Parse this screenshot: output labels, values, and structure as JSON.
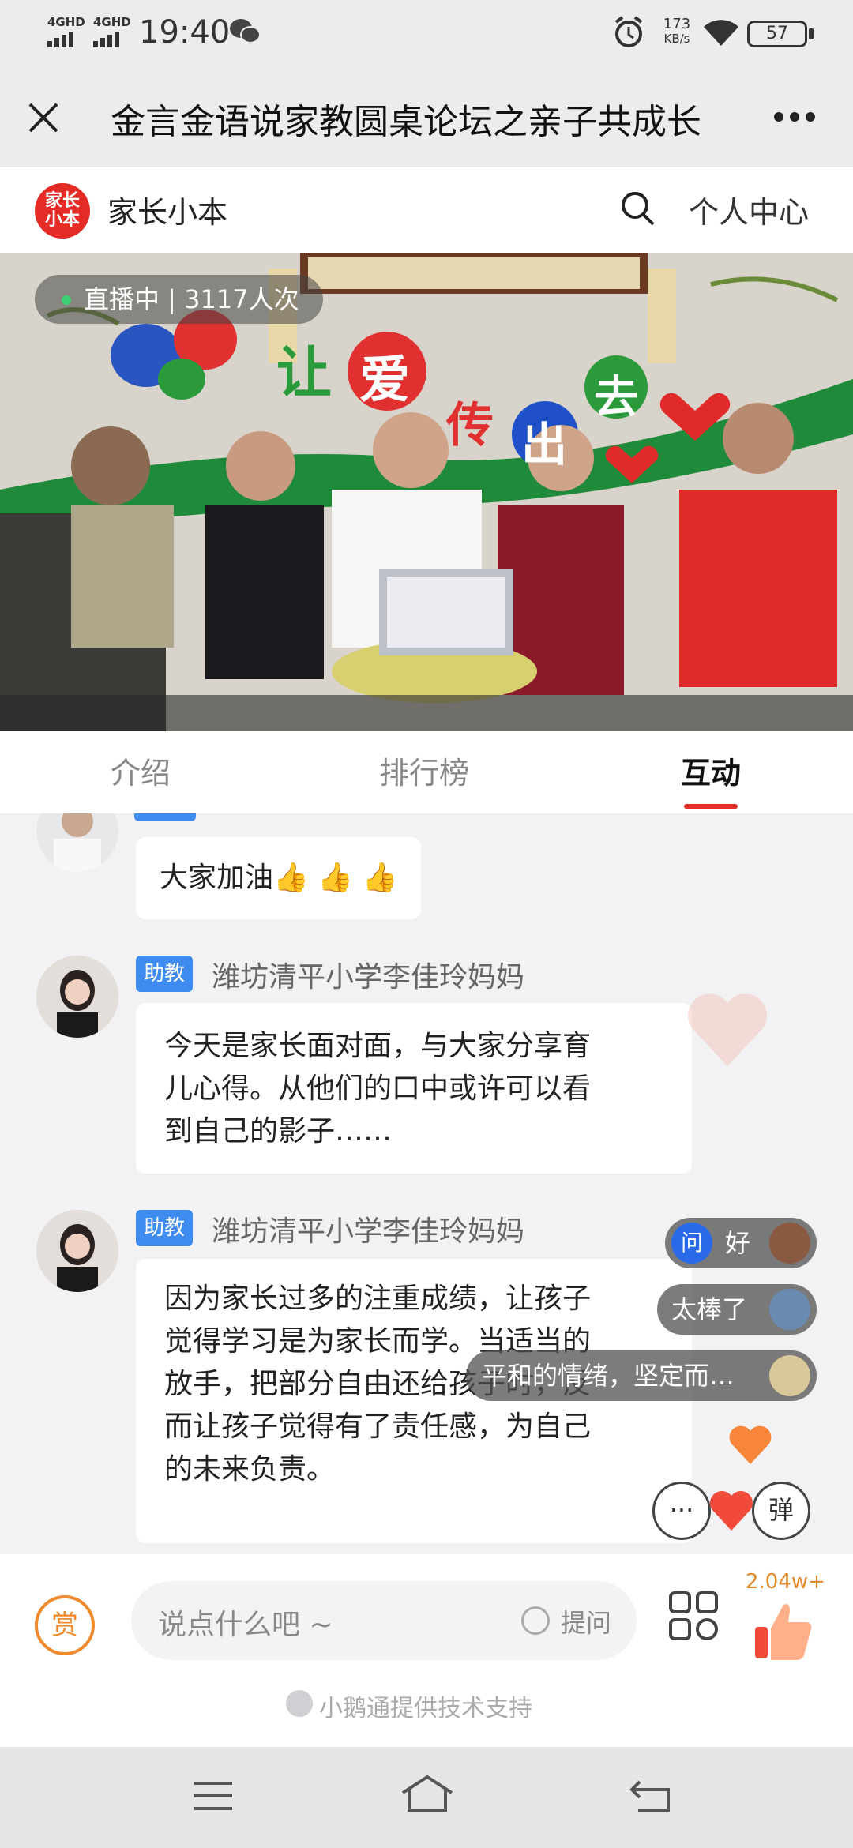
{
  "status_bar": {
    "sig1": "4GHD",
    "sig2": "4GHD",
    "time": "19:40",
    "net_speed_value": "173",
    "net_speed_unit": "KB/s",
    "battery": "57"
  },
  "title_bar": {
    "title": "金言金语说家教圆桌论坛之亲子共成长",
    "close_icon": "close-icon",
    "more_icon": "more-icon"
  },
  "app_header": {
    "logo_text_line1": "家长",
    "logo_text_line2": "小本",
    "brand": "家长小本",
    "search_icon": "search-icon",
    "personal_center": "个人中心",
    "brand_color": "#e52b25"
  },
  "video": {
    "live_status": "直播中 | 3117人次",
    "wall_slogan": [
      "让",
      "爱",
      "传",
      "出",
      "去"
    ]
  },
  "tabs": [
    {
      "label": "介绍",
      "active": false
    },
    {
      "label": "排行榜",
      "active": false
    },
    {
      "label": "互动",
      "active": true
    }
  ],
  "messages": [
    {
      "badge": "",
      "user": "",
      "text": "大家加油👍 👍 👍"
    },
    {
      "badge": "助教",
      "user": "潍坊清平小学李佳玲妈妈",
      "lines": [
        "今天是家长面对面，与大家分享育",
        "儿心得。从他们的口中或许可以看",
        "到自己的影子……"
      ]
    },
    {
      "badge": "助教",
      "user": "潍坊清平小学李佳玲妈妈",
      "lines": [
        "因为家长过多的注重成绩，让孩子",
        "觉得学习是为家长而学。当适当的",
        "放手，把部分自由还给孩子时，反",
        "而让孩子觉得有了责任感，为自己",
        "的未来负责。"
      ]
    }
  ],
  "danmaku": [
    {
      "tag": "问",
      "text": "好"
    },
    {
      "tag": "",
      "text": "太棒了"
    },
    {
      "tag": "",
      "text": "平和的情绪，坚定而…"
    }
  ],
  "danmaku_toggle": "弹",
  "bottom_bar": {
    "reward": "赏",
    "input_placeholder": "说点什么吧 ~",
    "ask_label": "提问",
    "grid_icon": "grid-icon",
    "like_count": "2.04w+",
    "support_text": "小鹅通提供技术支持"
  },
  "nav_bar": {
    "menu_icon": "menu-icon",
    "home_icon": "home-icon",
    "back_icon": "back-icon"
  },
  "colors": {
    "accent_red": "#e5302a",
    "badge_blue": "#3e8cf0",
    "reward_orange": "#f08a2e"
  }
}
